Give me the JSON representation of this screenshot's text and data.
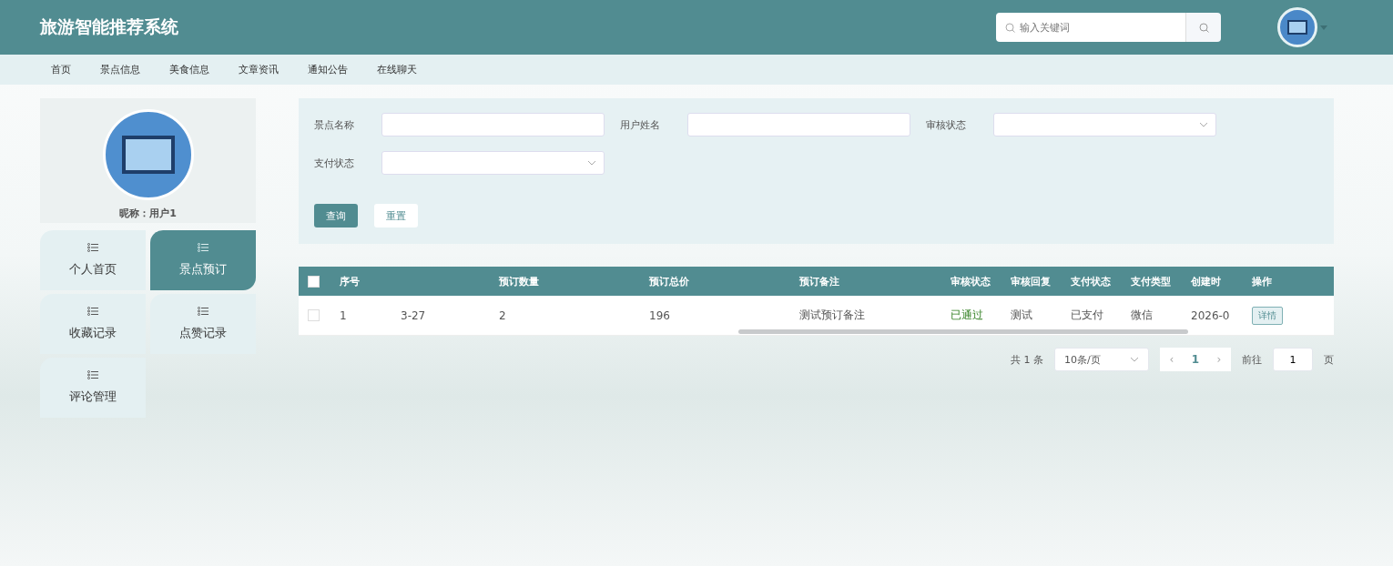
{
  "header": {
    "title": "旅游智能推荐系统",
    "search": {
      "placeholder": "输入关键词"
    }
  },
  "nav": [
    "首页",
    "景点信息",
    "美食信息",
    "文章资讯",
    "通知公告",
    "在线聊天"
  ],
  "profile": {
    "nickname": "昵称：用户1"
  },
  "menu": [
    {
      "label": "个人首页",
      "selected": false
    },
    {
      "label": "景点预订",
      "selected": true
    },
    {
      "label": "收藏记录",
      "selected": false
    },
    {
      "label": "点赞记录",
      "selected": false
    },
    {
      "label": "评论管理",
      "selected": false
    }
  ],
  "filters": [
    {
      "label": "景点名称",
      "kind": "text"
    },
    {
      "label": "用户姓名",
      "kind": "text"
    },
    {
      "label": "审核状态",
      "kind": "select"
    },
    {
      "label": "支付状态",
      "kind": "select"
    }
  ],
  "buttons": {
    "query": "查询",
    "reset": "重置"
  },
  "table": {
    "header_checked": false,
    "columns": [
      "序号",
      "",
      "预订数量",
      "预订总价",
      "预订备注",
      "审核状态",
      "审核回复",
      "支付状态",
      "支付类型",
      "创建时",
      "操作"
    ],
    "rows": [
      {
        "checked": false,
        "cells": [
          "1",
          "3-27",
          "2",
          "196",
          "测试预订备注",
          "已通过",
          "测试",
          "已支付",
          "微信",
          "2026-0"
        ],
        "approved": true,
        "action": "详情"
      }
    ]
  },
  "pagination": {
    "total": "共 1 条",
    "page_size": "10条/页",
    "prev": "‹",
    "page": "1",
    "next": "›",
    "goto_label": "前往",
    "goto_value": "1",
    "page_unit": "页"
  }
}
